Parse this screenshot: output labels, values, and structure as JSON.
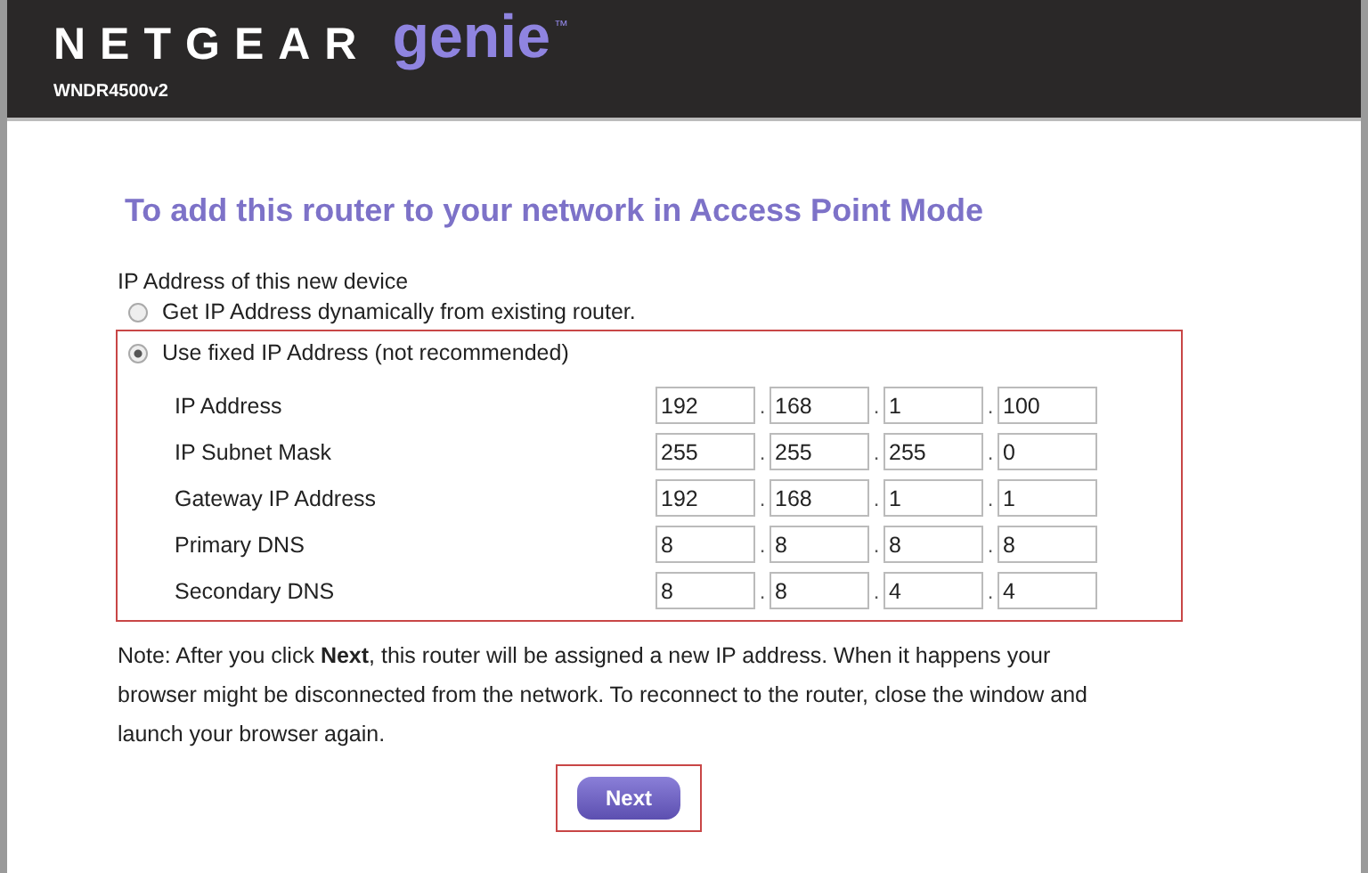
{
  "header": {
    "brand": "NETGEAR",
    "product": "genie",
    "trademark": "™",
    "model": "WNDR4500v2"
  },
  "title": "To add this router to your network in Access Point Mode",
  "section_label": "IP Address of this new device",
  "options": [
    {
      "label": "Get IP Address dynamically from existing router.",
      "selected": false
    },
    {
      "label": "Use fixed IP Address (not recommended)",
      "selected": true
    }
  ],
  "separator": ".",
  "fields": [
    {
      "label": "IP Address",
      "octets": [
        "192",
        "168",
        "1",
        "100"
      ]
    },
    {
      "label": "IP Subnet Mask",
      "octets": [
        "255",
        "255",
        "255",
        "0"
      ]
    },
    {
      "label": "Gateway IP Address",
      "octets": [
        "192",
        "168",
        "1",
        "1"
      ]
    },
    {
      "label": "Primary DNS",
      "octets": [
        "8",
        "8",
        "8",
        "8"
      ]
    },
    {
      "label": "Secondary DNS",
      "octets": [
        "8",
        "8",
        "4",
        "4"
      ]
    }
  ],
  "note": "Note: After you click **Next**, this router will be assigned a new IP address. When it happens your browser might be disconnected from the network. To reconnect to the router, close the window and launch your browser again.",
  "next_button": "Next"
}
